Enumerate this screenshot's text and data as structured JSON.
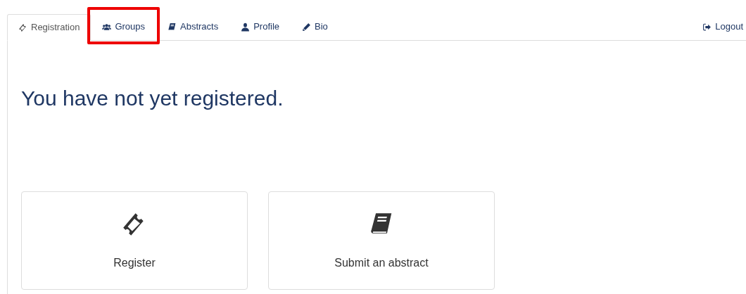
{
  "tabs": [
    {
      "label": "Registration",
      "kind": "ticket",
      "selected": true,
      "highlighted": false
    },
    {
      "label": "Groups",
      "kind": "users",
      "selected": false,
      "highlighted": true
    },
    {
      "label": "Abstracts",
      "kind": "book",
      "selected": false,
      "highlighted": false
    },
    {
      "label": "Profile",
      "kind": "user",
      "selected": false,
      "highlighted": false
    },
    {
      "label": "Bio",
      "kind": "pencil",
      "selected": false,
      "highlighted": false
    }
  ],
  "logout": {
    "label": "Logout"
  },
  "heading": "You have not yet registered.",
  "cards": [
    {
      "label": "Register",
      "kind": "ticket"
    },
    {
      "label": "Submit an abstract",
      "kind": "book"
    }
  ]
}
